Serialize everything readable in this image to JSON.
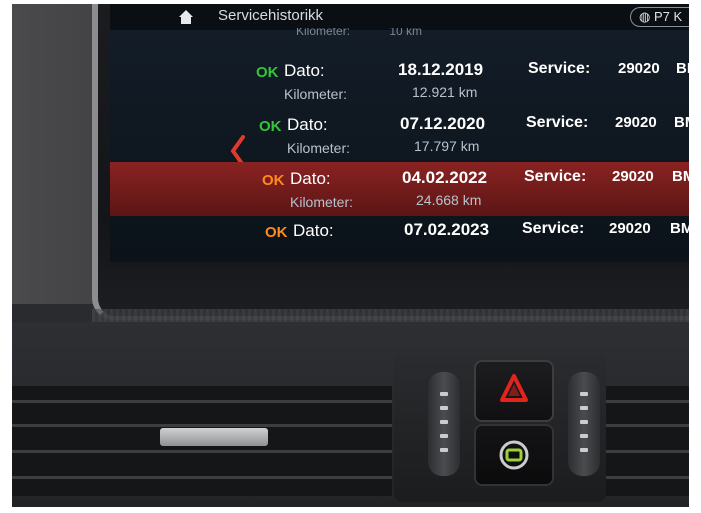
{
  "screen": {
    "title": "Servicehistorikk",
    "gear_chip": "P7 K",
    "partial_row": {
      "label": "Kilometer:",
      "value": "10 km"
    },
    "rows": [
      {
        "status": "OK",
        "date_label": "Dato:",
        "date": "18.12.2019",
        "km_label": "Kilometer:",
        "km": "12.921 km",
        "service_label": "Service:",
        "code": "29020",
        "brand": "BMW",
        "selected": false
      },
      {
        "status": "OK",
        "date_label": "Dato:",
        "date": "07.12.2020",
        "km_label": "Kilometer:",
        "km": "17.797 km",
        "service_label": "Service:",
        "code": "29020",
        "brand": "BMW",
        "selected": false
      },
      {
        "status": "OK",
        "date_label": "Dato:",
        "date": "04.02.2022",
        "km_label": "Kilometer:",
        "km": "24.668 km",
        "service_label": "Service:",
        "code": "29020",
        "brand": "BMW",
        "selected": true
      },
      {
        "status": "OK",
        "date_label": "Dato:",
        "date": "07.02.2023",
        "km_label": "",
        "km": "",
        "service_label": "Service:",
        "code": "29020",
        "brand": "BMW",
        "selected": false
      }
    ]
  },
  "colors": {
    "ok_green": "#35c43a",
    "ok_orange": "#ff8a1e",
    "selection_red": "#8a2322",
    "hazard_red": "#e0241e",
    "lock_green": "#9bd13a"
  },
  "icons": [
    "home-icon",
    "back-chevron-icon",
    "hazard-warning-icon",
    "central-lock-icon"
  ]
}
